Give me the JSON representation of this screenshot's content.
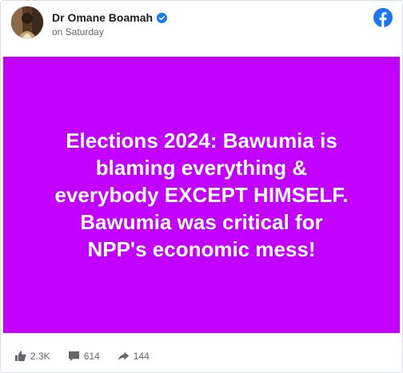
{
  "post": {
    "author": "Dr Omane Boamah",
    "timestamp": "on Saturday",
    "banner_text": "Elections 2024: Bawumia is\nblaming everything &\neverybody EXCEPT HIMSELF.\nBawumia was critical for\nNPP's economic mess!",
    "banner_color": "#c200ff",
    "likes": "2.3K",
    "comments": "614",
    "shares": "144"
  },
  "icons": {
    "platform": "facebook-icon",
    "verified": "verified-badge-icon",
    "like": "thumbs-up-icon",
    "comment": "comment-bubble-icon",
    "share": "share-arrow-icon"
  },
  "colors": {
    "brand_blue": "#1877f2",
    "meta_text": "#65676b"
  }
}
